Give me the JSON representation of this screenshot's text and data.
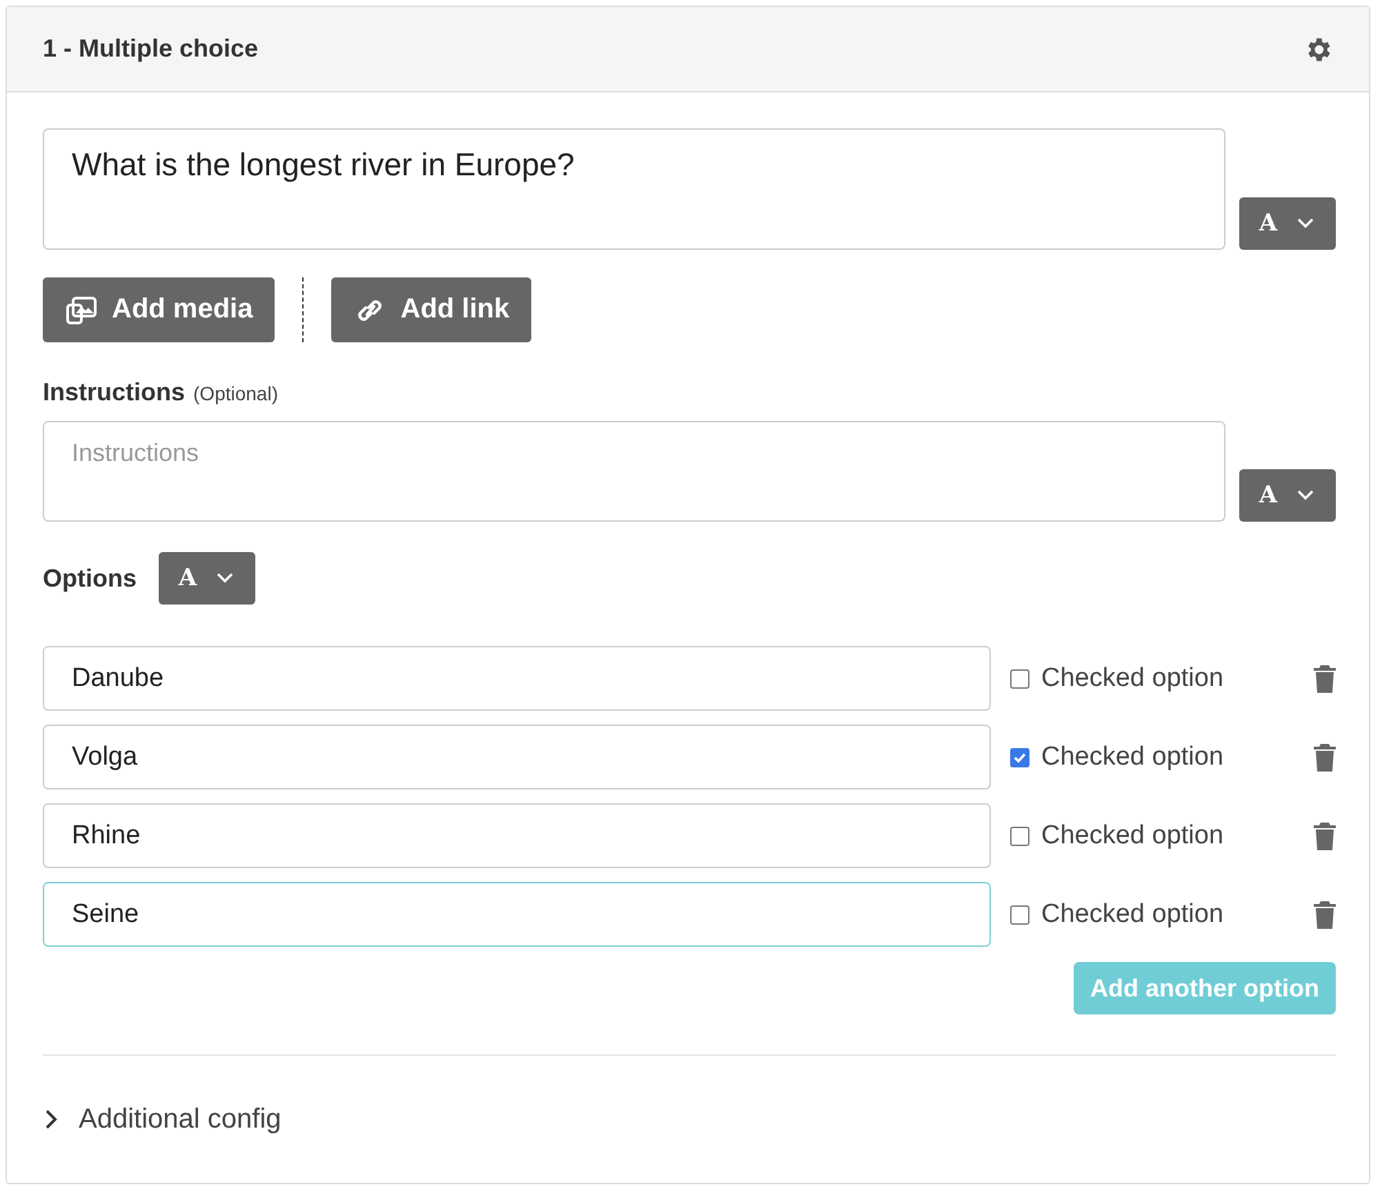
{
  "header": {
    "title": "1 - Multiple choice"
  },
  "question": {
    "value": "What is the longest river in Europe?",
    "font_button": "A"
  },
  "media_buttons": [
    {
      "kind": "media",
      "label": "Add media"
    },
    {
      "kind": "link",
      "label": "Add link"
    }
  ],
  "instructions": {
    "label": "Instructions",
    "hint": "(Optional)",
    "placeholder": "Instructions",
    "font_button": "A"
  },
  "options": {
    "label": "Options",
    "font_button": "A",
    "items": [
      {
        "value": "Danube",
        "focused": false,
        "checked": false,
        "check_label": "Checked option"
      },
      {
        "value": "Volga",
        "focused": false,
        "checked": true,
        "check_label": "Checked option"
      },
      {
        "value": "Rhine",
        "focused": false,
        "checked": false,
        "check_label": "Checked option"
      },
      {
        "value": "Seine",
        "focused": true,
        "checked": false,
        "check_label": "Checked option"
      }
    ],
    "add_button": "Add another option"
  },
  "additional_config": {
    "label": "Additional config",
    "expanded": false
  }
}
